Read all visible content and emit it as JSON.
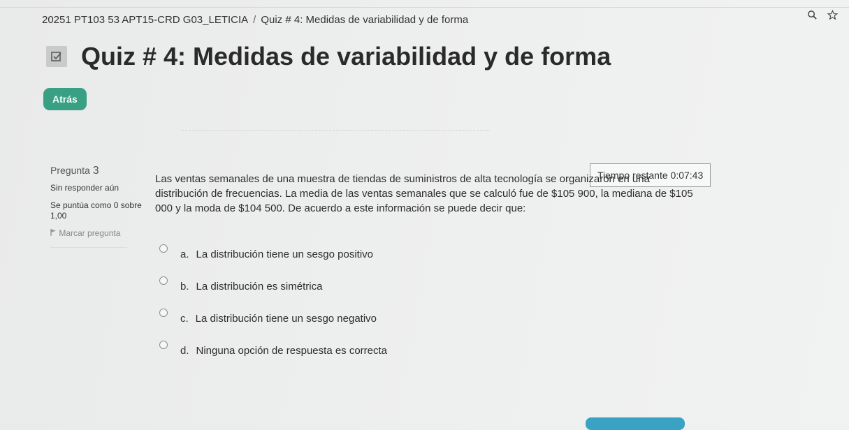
{
  "breadcrumb": {
    "course": "20251 PT103 53 APT15-CRD G03_LETICIA",
    "separator": "/",
    "current": "Quiz # 4: Medidas de variabilidad y de forma"
  },
  "page": {
    "title": "Quiz # 4: Medidas de variabilidad y de forma",
    "back_label": "Atrás"
  },
  "question_info": {
    "label": "Pregunta",
    "number": "3",
    "state": "Sin responder aún",
    "grade": "Se puntúa como 0 sobre 1,00",
    "flag": "Marcar pregunta"
  },
  "timer": {
    "label": "Tiempo restante",
    "value": "0:07:43"
  },
  "question": {
    "text": "Las ventas semanales de una muestra de tiendas de suministros de alta tecnología se organizaron en una distribución de frecuencias. La media de las ventas semanales que se calculó fue de $105 900, la mediana de $105 000 y la moda de $104 500. De acuerdo a este información se puede decir que:"
  },
  "answers": [
    {
      "letter": "a.",
      "text": "La distribución tiene un sesgo positivo"
    },
    {
      "letter": "b.",
      "text": "La distribución es simétrica"
    },
    {
      "letter": "c.",
      "text": "La distribución tiene un sesgo negativo"
    },
    {
      "letter": "d.",
      "text": "Ninguna opción de respuesta es correcta"
    }
  ],
  "colors": {
    "accent_green": "#3aa083",
    "accent_blue": "#3aa3c4"
  },
  "icons": [
    "quiz-icon",
    "search-icon",
    "star-icon",
    "flag-icon"
  ]
}
